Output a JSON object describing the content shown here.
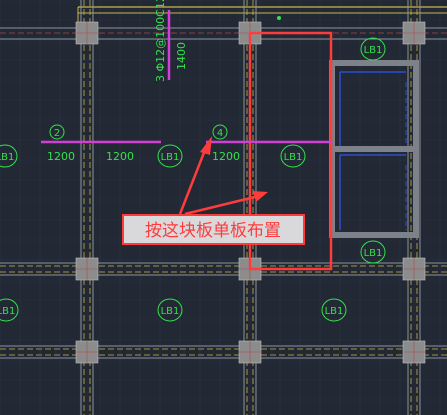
{
  "drawing": {
    "background": "#222834",
    "colors": {
      "grid": "#2e3646",
      "beam_white": "#8e939c",
      "beam_yellow": "#c8b64a",
      "beam_red": "#b04848",
      "column": "#8c8c8c",
      "magenta": "#d13fd6",
      "green": "#33e24a",
      "blue": "#2c4fd0",
      "gray_pipe": "#7d828a",
      "highlight_red": "#ff3c3c",
      "annotation_text": "#ff3b3b",
      "annotation_bg": "#d9d9dc"
    },
    "slab_labels": {
      "lb_tr": "LB1",
      "lb_l": "LB1",
      "lb_c": "LB1",
      "lb_r": "LB1",
      "lb_pr": "LB1",
      "lb_bl": "LB1",
      "lb_bc": "LB1",
      "lb_br": "LB1"
    },
    "rebar_left": {
      "number": "2",
      "left_len": "1200",
      "right_len": "1200"
    },
    "rebar_mid": {
      "number": "4",
      "left_len": "1200"
    },
    "rebar_vertical": {
      "spec": "3 Φ12@100C12",
      "len": "1400"
    },
    "annotation": {
      "text": "按这块板单板布置"
    }
  }
}
